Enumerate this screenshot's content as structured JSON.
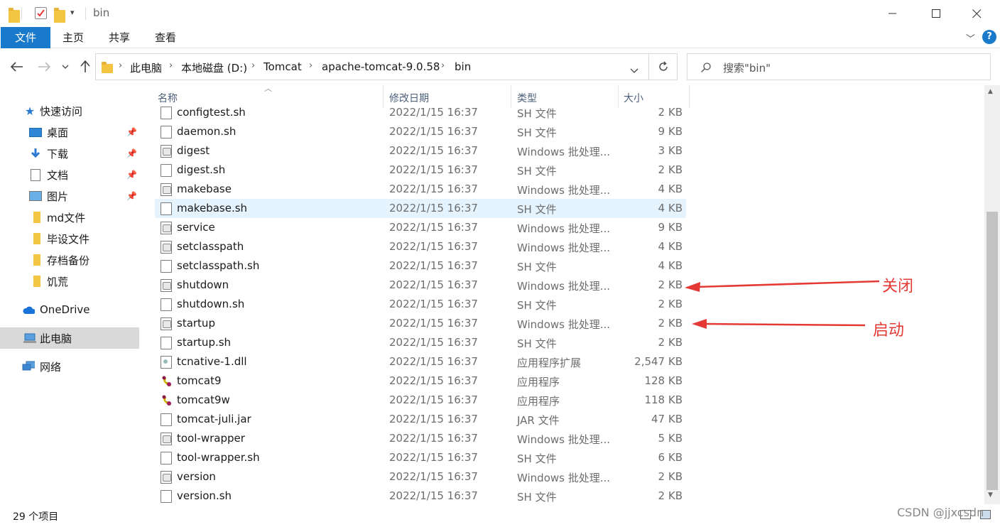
{
  "window": {
    "title": "bin",
    "minimize_icon": "minimize-icon",
    "maximize_icon": "maximize-icon",
    "close_icon": "close-icon"
  },
  "ribbon": {
    "tabs": [
      {
        "label": "文件",
        "active": true
      },
      {
        "label": "主页"
      },
      {
        "label": "共享"
      },
      {
        "label": "查看"
      }
    ],
    "help_glyph": "?"
  },
  "address": {
    "crumbs": [
      "此电脑",
      "本地磁盘 (D:)",
      "Tomcat",
      "apache-tomcat-9.0.58",
      "bin"
    ]
  },
  "search": {
    "placeholder": "搜索\"bin\""
  },
  "nav": {
    "items": [
      {
        "label": "快速访问",
        "icon": "star-icon"
      },
      {
        "label": "桌面",
        "icon": "desktop-icon",
        "pinned": true
      },
      {
        "label": "下载",
        "icon": "download-icon",
        "pinned": true
      },
      {
        "label": "文档",
        "icon": "document-icon",
        "pinned": true
      },
      {
        "label": "图片",
        "icon": "picture-icon",
        "pinned": true
      },
      {
        "label": "md文件",
        "icon": "folder-icon"
      },
      {
        "label": "毕设文件",
        "icon": "folder-icon"
      },
      {
        "label": "存档备份",
        "icon": "folder-icon"
      },
      {
        "label": "饥荒",
        "icon": "folder-icon"
      },
      {
        "label": "OneDrive",
        "icon": "cloud-icon"
      },
      {
        "label": "此电脑",
        "icon": "computer-icon",
        "selected": true
      },
      {
        "label": "网络",
        "icon": "network-icon"
      }
    ]
  },
  "columns": {
    "name": "名称",
    "date": "修改日期",
    "type": "类型",
    "size": "大小"
  },
  "files": [
    {
      "name": "configtest.sh",
      "date": "2022/1/15 16:37",
      "type": "SH 文件",
      "size": "2 KB",
      "icon": "doc-icon"
    },
    {
      "name": "daemon.sh",
      "date": "2022/1/15 16:37",
      "type": "SH 文件",
      "size": "9 KB",
      "icon": "doc-icon"
    },
    {
      "name": "digest",
      "date": "2022/1/15 16:37",
      "type": "Windows 批处理...",
      "size": "3 KB",
      "icon": "batch-icon"
    },
    {
      "name": "digest.sh",
      "date": "2022/1/15 16:37",
      "type": "SH 文件",
      "size": "2 KB",
      "icon": "doc-icon"
    },
    {
      "name": "makebase",
      "date": "2022/1/15 16:37",
      "type": "Windows 批处理...",
      "size": "4 KB",
      "icon": "batch-icon"
    },
    {
      "name": "makebase.sh",
      "date": "2022/1/15 16:37",
      "type": "SH 文件",
      "size": "4 KB",
      "icon": "doc-icon",
      "hover": true
    },
    {
      "name": "service",
      "date": "2022/1/15 16:37",
      "type": "Windows 批处理...",
      "size": "9 KB",
      "icon": "batch-icon"
    },
    {
      "name": "setclasspath",
      "date": "2022/1/15 16:37",
      "type": "Windows 批处理...",
      "size": "4 KB",
      "icon": "batch-icon"
    },
    {
      "name": "setclasspath.sh",
      "date": "2022/1/15 16:37",
      "type": "SH 文件",
      "size": "4 KB",
      "icon": "doc-icon"
    },
    {
      "name": "shutdown",
      "date": "2022/1/15 16:37",
      "type": "Windows 批处理...",
      "size": "2 KB",
      "icon": "batch-icon"
    },
    {
      "name": "shutdown.sh",
      "date": "2022/1/15 16:37",
      "type": "SH 文件",
      "size": "2 KB",
      "icon": "doc-icon"
    },
    {
      "name": "startup",
      "date": "2022/1/15 16:37",
      "type": "Windows 批处理...",
      "size": "2 KB",
      "icon": "batch-icon"
    },
    {
      "name": "startup.sh",
      "date": "2022/1/15 16:37",
      "type": "SH 文件",
      "size": "2 KB",
      "icon": "doc-icon"
    },
    {
      "name": "tcnative-1.dll",
      "date": "2022/1/15 16:37",
      "type": "应用程序扩展",
      "size": "2,547 KB",
      "icon": "dll-icon"
    },
    {
      "name": "tomcat9",
      "date": "2022/1/15 16:37",
      "type": "应用程序",
      "size": "128 KB",
      "icon": "tomcat-exe-icon"
    },
    {
      "name": "tomcat9w",
      "date": "2022/1/15 16:37",
      "type": "应用程序",
      "size": "118 KB",
      "icon": "tomcat-exe-icon"
    },
    {
      "name": "tomcat-juli.jar",
      "date": "2022/1/15 16:37",
      "type": "JAR 文件",
      "size": "47 KB",
      "icon": "doc-icon"
    },
    {
      "name": "tool-wrapper",
      "date": "2022/1/15 16:37",
      "type": "Windows 批处理...",
      "size": "5 KB",
      "icon": "batch-icon"
    },
    {
      "name": "tool-wrapper.sh",
      "date": "2022/1/15 16:37",
      "type": "SH 文件",
      "size": "6 KB",
      "icon": "doc-icon"
    },
    {
      "name": "version",
      "date": "2022/1/15 16:37",
      "type": "Windows 批处理...",
      "size": "2 KB",
      "icon": "batch-icon"
    },
    {
      "name": "version.sh",
      "date": "2022/1/15 16:37",
      "type": "SH 文件",
      "size": "2 KB",
      "icon": "doc-icon"
    }
  ],
  "annotations": {
    "close_label": "关闭",
    "start_label": "启动",
    "color": "#e53935"
  },
  "status": {
    "item_count": "29 个项目"
  },
  "watermark": "CSDN @jjxcsdn",
  "colors": {
    "accent": "#1979ca",
    "hover_row": "#e5f3ff",
    "selected_nav": "#d9d9d9"
  }
}
